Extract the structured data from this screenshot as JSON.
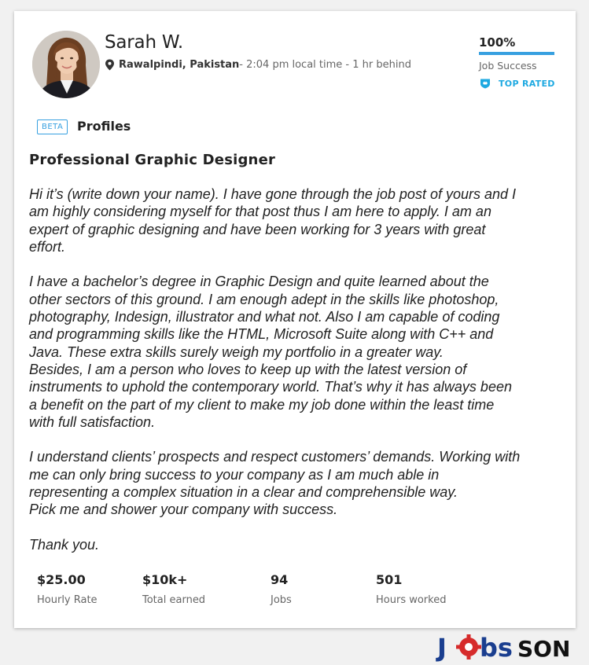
{
  "profile": {
    "name": "Sarah W.",
    "location": "Rawalpindi, Pakistan",
    "local_time": " - 2:04 pm local time - 1 hr behind",
    "job_success_value": "100%",
    "job_success_fraction": 1.0,
    "job_success_label": "Job Success",
    "top_rated_label": "TOP RATED",
    "colors": {
      "accent": "#37a0e0",
      "top_rated": "#1ea9e1"
    }
  },
  "section": {
    "beta_label": "BETA",
    "profiles_label": "Profiles"
  },
  "proposal": {
    "title": "Professional Graphic Designer",
    "paragraphs": [
      "Hi it’s (write down your name). I have gone through the job post of yours and I\nam highly considering myself for that post thus I am here to apply. I am an\nexpert of graphic designing and have been working for 3 years with great\neffort.",
      "I have a bachelor’s degree in Graphic Design and quite learned about the\nother sectors of this ground. I am enough adept in the skills like photoshop,\nphotography, Indesign, illustrator and what not. Also I am capable of coding\nand programming skills like the HTML, Microsoft Suite along with C++ and\nJava. These extra skills surely weigh my portfolio in a greater way.\nBesides, I am a person who loves to keep up with the latest version of\ninstruments to uphold the contemporary world. That’s why it has always been\na benefit on the part of my client to make my job done within the least time\nwith full satisfaction.",
      "I understand clients’ prospects and respect customers’ demands. Working with\nme can only bring success to your company as I am much able in\nrepresenting a complex situation in a clear and comprehensible way.\nPick me and shower your company with success.",
      "Thank you."
    ]
  },
  "stats": [
    {
      "value": "$25.00",
      "label": "Hourly Rate"
    },
    {
      "value": "$10k+",
      "label": "Total earned"
    },
    {
      "value": "94",
      "label": "Jobs"
    },
    {
      "value": "501",
      "label": "Hours worked"
    }
  ],
  "watermark": {
    "text_part1": "J",
    "text_part2": "bs",
    "text_part3": "SON",
    "colors": {
      "blue": "#1a3e8f",
      "red": "#d62b2b",
      "black": "#111111"
    }
  },
  "icons": {
    "location": "map-pin-icon",
    "top_rated": "shield-badge-icon",
    "watermark_gear": "gear-icon"
  }
}
